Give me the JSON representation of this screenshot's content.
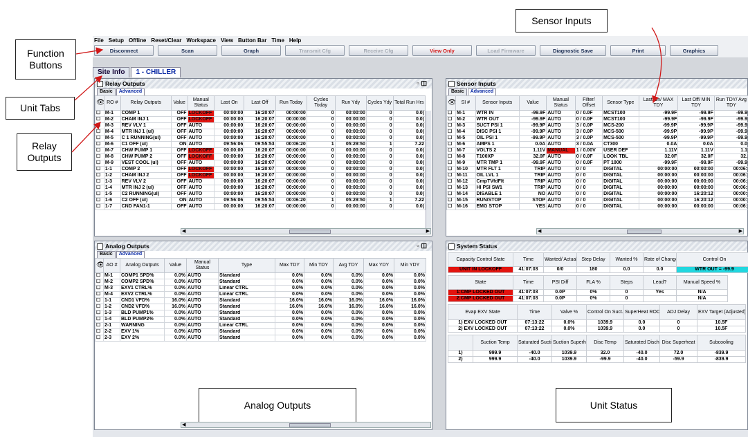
{
  "callouts": {
    "function_buttons": "Function\nButtons",
    "unit_tabs": "Unit Tabs",
    "relay_outputs": "Relay\nOutputs",
    "sensor_inputs": "Sensor Inputs",
    "analog_outputs": "Analog Outputs",
    "unit_status": "Unit Status"
  },
  "menu": [
    "File",
    "Setup",
    "Offline",
    "Reset/Clear",
    "Workspace",
    "View",
    "Button Bar",
    "Time",
    "Help"
  ],
  "toolbar": [
    {
      "label": "Disconnect",
      "state": "normal"
    },
    {
      "label": "Scan",
      "state": "normal"
    },
    {
      "label": "Graph",
      "state": "normal"
    },
    {
      "label": "Transmit Cfg",
      "state": "disabled"
    },
    {
      "label": "Receive Cfg",
      "state": "disabled"
    },
    {
      "label": "View Only",
      "state": "alert"
    },
    {
      "label": "Load Firmware",
      "state": "disabled"
    },
    {
      "label": "Diagnostic Save",
      "state": "normal"
    },
    {
      "label": "Print",
      "state": "normal"
    },
    {
      "label": "Graphics",
      "state": "normal"
    }
  ],
  "tabs": {
    "site": "Site Info",
    "unit": "1 - CHILLER"
  },
  "subtabs": {
    "basic": "Basic",
    "advanced": "Advanced"
  },
  "relay": {
    "title": "Relay Outputs",
    "columns": [
      "RO #",
      "Relay Outputs",
      "Value",
      "Manual Status",
      "Last On",
      "Last Off",
      "Run Today",
      "Cycles Today",
      "Run Ydy",
      "Cycles Ydy",
      "Total Run Hrs"
    ],
    "rows": [
      [
        "M-1",
        "COMP 1",
        "OFF",
        "LOCKOFF",
        "00:00:00",
        "16:20:07",
        "00:00:00",
        "0",
        "00:00:00",
        "0",
        "0.0("
      ],
      [
        "M-2",
        "CHAM INJ 1",
        "OFF",
        "LOCKOFF",
        "00:00:00",
        "16:20:07",
        "00:00:00",
        "0",
        "00:00:00",
        "0",
        "0.0("
      ],
      [
        "M-3",
        "REV VLV 1",
        "OFF",
        "AUTO",
        "00:00:00",
        "16:20:07",
        "00:00:00",
        "0",
        "00:00:00",
        "0",
        "0.0("
      ],
      [
        "M-4",
        "MTR INJ 1 (ul)",
        "OFF",
        "AUTO",
        "00:00:00",
        "16:20:07",
        "00:00:00",
        "0",
        "00:00:00",
        "0",
        "0.0("
      ],
      [
        "M-5",
        "C 1 RUNNING(ul)",
        "OFF",
        "AUTO",
        "00:00:00",
        "16:20:07",
        "00:00:00",
        "0",
        "00:00:00",
        "0",
        "0.0("
      ],
      [
        "M-6",
        "C1 OFF (ul)",
        "ON",
        "AUTO",
        "09:56:06",
        "09:55:53",
        "00:06:20",
        "1",
        "05:29:50",
        "1",
        "7.22"
      ],
      [
        "M-7",
        "CHW PUMP 1",
        "OFF",
        "LOCKOFF",
        "00:00:00",
        "16:20:07",
        "00:00:00",
        "0",
        "00:00:00",
        "0",
        "0.0("
      ],
      [
        "M-8",
        "CHW PUMP 2",
        "OFF",
        "LOCKOFF",
        "00:00:00",
        "16:20:07",
        "00:00:00",
        "0",
        "00:00:00",
        "0",
        "0.0("
      ],
      [
        "M-9",
        "VEST COOL (ul)",
        "OFF",
        "AUTO",
        "00:00:00",
        "16:20:07",
        "00:00:00",
        "0",
        "00:00:00",
        "0",
        "0.0("
      ],
      [
        "1-1",
        "COMP 2",
        "OFF",
        "LOCKOFF",
        "00:00:00",
        "16:20:07",
        "00:00:00",
        "0",
        "00:00:00",
        "0",
        "0.0("
      ],
      [
        "1-2",
        "CHAM INJ 2",
        "OFF",
        "LOCKOFF",
        "00:00:00",
        "16:20:07",
        "00:00:00",
        "0",
        "00:00:00",
        "0",
        "0.0("
      ],
      [
        "1-3",
        "REV VLV 2",
        "OFF",
        "AUTO",
        "00:00:00",
        "16:20:07",
        "00:00:00",
        "0",
        "00:00:00",
        "0",
        "0.0("
      ],
      [
        "1-4",
        "MTR INJ 2 (ul)",
        "OFF",
        "AUTO",
        "00:00:00",
        "16:20:07",
        "00:00:00",
        "0",
        "00:00:00",
        "0",
        "0.0("
      ],
      [
        "1-5",
        "C2 RUNNING(ul)",
        "OFF",
        "AUTO",
        "00:00:00",
        "16:20:07",
        "00:00:00",
        "0",
        "00:00:00",
        "0",
        "0.0("
      ],
      [
        "1-6",
        "C2 OFF (ul)",
        "ON",
        "AUTO",
        "09:56:06",
        "09:55:53",
        "00:06:20",
        "1",
        "05:29:50",
        "1",
        "7.22"
      ],
      [
        "1-7",
        "CND FAN1-1",
        "OFF",
        "AUTO",
        "00:00:00",
        "16:20:07",
        "00:00:00",
        "0",
        "00:00:00",
        "0",
        "0.0("
      ]
    ]
  },
  "sensor": {
    "title": "Sensor Inputs",
    "columns": [
      "SI #",
      "Sensor Inputs",
      "Value",
      "Manual Status",
      "Filter/ Offset",
      "Sensor Type",
      "Last On/ MAX TDY",
      "Last Off/ MIN TDY",
      "Run TDY/ Avg TDY"
    ],
    "rows": [
      [
        "M-1",
        "WTR IN",
        "-99.9F",
        "AUTO",
        "0 / 0.0F",
        "MCST100",
        "-99.9F",
        "-99.9F",
        "-99.9"
      ],
      [
        "M-2",
        "WTR OUT",
        "-99.9F",
        "AUTO",
        "0 / 0.0F",
        "MCST100",
        "-99.9F",
        "-99.9F",
        "-99.9"
      ],
      [
        "M-3",
        "SUCT PSI 1",
        "-99.9P",
        "AUTO",
        "3 / 0.0P",
        "MCS-200",
        "-99.9P",
        "-99.9P",
        "-99.9"
      ],
      [
        "M-4",
        "DISC PSI 1",
        "-99.9P",
        "AUTO",
        "3 / 0.0P",
        "MCS-500",
        "-99.9P",
        "-99.9P",
        "-99.9"
      ],
      [
        "M-5",
        "OIL PSI 1",
        "-99.9P",
        "AUTO",
        "3 / 0.0P",
        "MCS-500",
        "-99.9P",
        "-99.9P",
        "-99.9"
      ],
      [
        "M-6",
        "AMPS 1",
        "0.0A",
        "AUTO",
        "3 / 0.0A",
        "CT300",
        "0.0A",
        "0.0A",
        "0.0"
      ],
      [
        "M-7",
        "VOLTS 2",
        "1.11V",
        "MANUAL",
        "1 / 0.00V",
        "USER DEF",
        "1.11V",
        "1.11V",
        "1.1"
      ],
      [
        "M-8",
        "T100XP",
        "32.0F",
        "AUTO",
        "0 / 0.0F",
        "LOOK TBL",
        "32.0F",
        "32.0F",
        "32."
      ],
      [
        "M-9",
        "MTR TMP 1",
        "-99.9F",
        "AUTO",
        "0 / 0.0F",
        "PT 1000",
        "-99.9F",
        "-99.9F",
        "-99.9"
      ],
      [
        "M-10",
        "MTR FLT 1",
        "TRIP",
        "AUTO",
        "0 / 0",
        "DIGITAL",
        "00:00:00",
        "00:00:00",
        "00:06:"
      ],
      [
        "M-11",
        "OIL LVL 1",
        "TRIP",
        "AUTO",
        "0 / 0",
        "DIGITAL",
        "00:00:00",
        "00:00:00",
        "00:06:"
      ],
      [
        "M-12",
        "CmpTVfdFlt",
        "TRIP",
        "AUTO",
        "0 / 0",
        "DIGITAL",
        "00:00:00",
        "00:00:00",
        "00:06:"
      ],
      [
        "M-13",
        "HI PSI SW1",
        "TRIP",
        "AUTO",
        "0 / 0",
        "DIGITAL",
        "00:00:00",
        "00:00:00",
        "00:06:"
      ],
      [
        "M-14",
        "DISABLE 1",
        "NO",
        "AUTO",
        "0 / 0",
        "DIGITAL",
        "00:00:00",
        "16:20:12",
        "00:00:"
      ],
      [
        "M-15",
        "RUN/STOP",
        "STOP",
        "AUTO",
        "0 / 0",
        "DIGITAL",
        "00:00:00",
        "16:20:12",
        "00:00:"
      ],
      [
        "M-16",
        "EMG STOP",
        "YES",
        "AUTO",
        "0 / 0",
        "DIGITAL",
        "00:00:00",
        "00:00:00",
        "00:06:"
      ]
    ]
  },
  "analog": {
    "title": "Analog Outputs",
    "columns": [
      "AO #",
      "Analog Outputs",
      "Value",
      "Manual Status",
      "Type",
      "Max TDY",
      "Min TDY",
      "Avg TDY",
      "Max YDY",
      "Min YDY"
    ],
    "rows": [
      [
        "M-1",
        "COMP1 SPD%",
        "0.0%",
        "AUTO",
        "Standard",
        "0.0%",
        "0.0%",
        "0.0%",
        "0.0%",
        "0.0%"
      ],
      [
        "M-2",
        "COMP2 SPD%",
        "0.0%",
        "AUTO",
        "Standard",
        "0.0%",
        "0.0%",
        "0.0%",
        "0.0%",
        "0.0%"
      ],
      [
        "M-3",
        "EXV1 CTRL%",
        "0.0%",
        "AUTO",
        "Linear CTRL",
        "0.0%",
        "0.0%",
        "0.0%",
        "0.0%",
        "0.0%"
      ],
      [
        "M-4",
        "EXV2 CTRL%",
        "0.0%",
        "AUTO",
        "Linear CTRL",
        "0.0%",
        "0.0%",
        "0.0%",
        "0.0%",
        "0.0%"
      ],
      [
        "1-1",
        "CND1 VFD%",
        "16.0%",
        "AUTO",
        "Standard",
        "16.0%",
        "16.0%",
        "16.0%",
        "16.0%",
        "16.0%"
      ],
      [
        "1-2",
        "CND2 VFD%",
        "16.0%",
        "AUTO",
        "Standard",
        "16.0%",
        "16.0%",
        "16.0%",
        "16.0%",
        "16.0%"
      ],
      [
        "1-3",
        "BLD PUMP1%",
        "0.0%",
        "AUTO",
        "Standard",
        "0.0%",
        "0.0%",
        "0.0%",
        "0.0%",
        "0.0%"
      ],
      [
        "1-4",
        "BLD PUMP2%",
        "0.0%",
        "AUTO",
        "Standard",
        "0.0%",
        "0.0%",
        "0.0%",
        "0.0%",
        "0.0%"
      ],
      [
        "2-1",
        "WARNING",
        "0.0%",
        "AUTO",
        "Linear CTRL",
        "0.0%",
        "0.0%",
        "0.0%",
        "0.0%",
        "0.0%"
      ],
      [
        "2-2",
        "EXV 1%",
        "0.0%",
        "AUTO",
        "Standard",
        "0.0%",
        "0.0%",
        "0.0%",
        "0.0%",
        "0.0%"
      ],
      [
        "2-3",
        "EXV 2%",
        "0.0%",
        "AUTO",
        "Standard",
        "0.0%",
        "0.0%",
        "0.0%",
        "0.0%",
        "0.0%"
      ]
    ]
  },
  "system": {
    "title": "System Status",
    "s1h": [
      "Capacity Control State",
      "Time",
      "Wanted/ Actual",
      "Step Delay",
      "Wanted %",
      "Rate of Change",
      "Control On"
    ],
    "s1v": [
      "UNIT IN LOCKOFF",
      "41:07:03",
      "0/0",
      "180",
      "0.0",
      "0.0",
      "WTR OUT = -99.9"
    ],
    "s2h": [
      "State",
      "Time",
      "PSI Diff",
      "FLA %",
      "Steps",
      "Lead?",
      "Manual Speed %"
    ],
    "s2r": [
      [
        "1:CMP LOCKED OUT",
        "41:07:03",
        "0.0P",
        "0%",
        "0",
        "Yes",
        "N/A"
      ],
      [
        "2:CMP LOCKED OUT",
        "41:07:03",
        "0.0P",
        "0%",
        "0",
        "",
        "N/A"
      ]
    ],
    "s3h": [
      "Evap EXV State",
      "Time",
      "Valve %",
      "Control On Suct. Supht",
      "SuperHeat ROC",
      "ADJ Delay",
      "EXV Target (Adjusted)"
    ],
    "s3r": [
      [
        "1) EXV LOCKED OUT",
        "07:13:22",
        "0.0%",
        "1039.9",
        "0.0",
        "0",
        "10.5F"
      ],
      [
        "2) EXV LOCKED OUT",
        "07:13:22",
        "0.0%",
        "1039.9",
        "0.0",
        "0",
        "10.5F"
      ]
    ],
    "s4h": [
      "",
      "Suction Temp",
      "Saturated Suction",
      "Suction Superheat",
      "Disc Temp",
      "Saturated Discharge",
      "Disc Superheat",
      "Subcooling"
    ],
    "s4r": [
      [
        "1)",
        "999.9",
        "-40.0",
        "1039.9",
        "32.0",
        "-40.0",
        "72.0",
        "-839.9"
      ],
      [
        "2)",
        "999.9",
        "-40.0",
        "1039.9",
        "-99.9",
        "-40.0",
        "-59.9",
        "-839.9"
      ]
    ]
  }
}
